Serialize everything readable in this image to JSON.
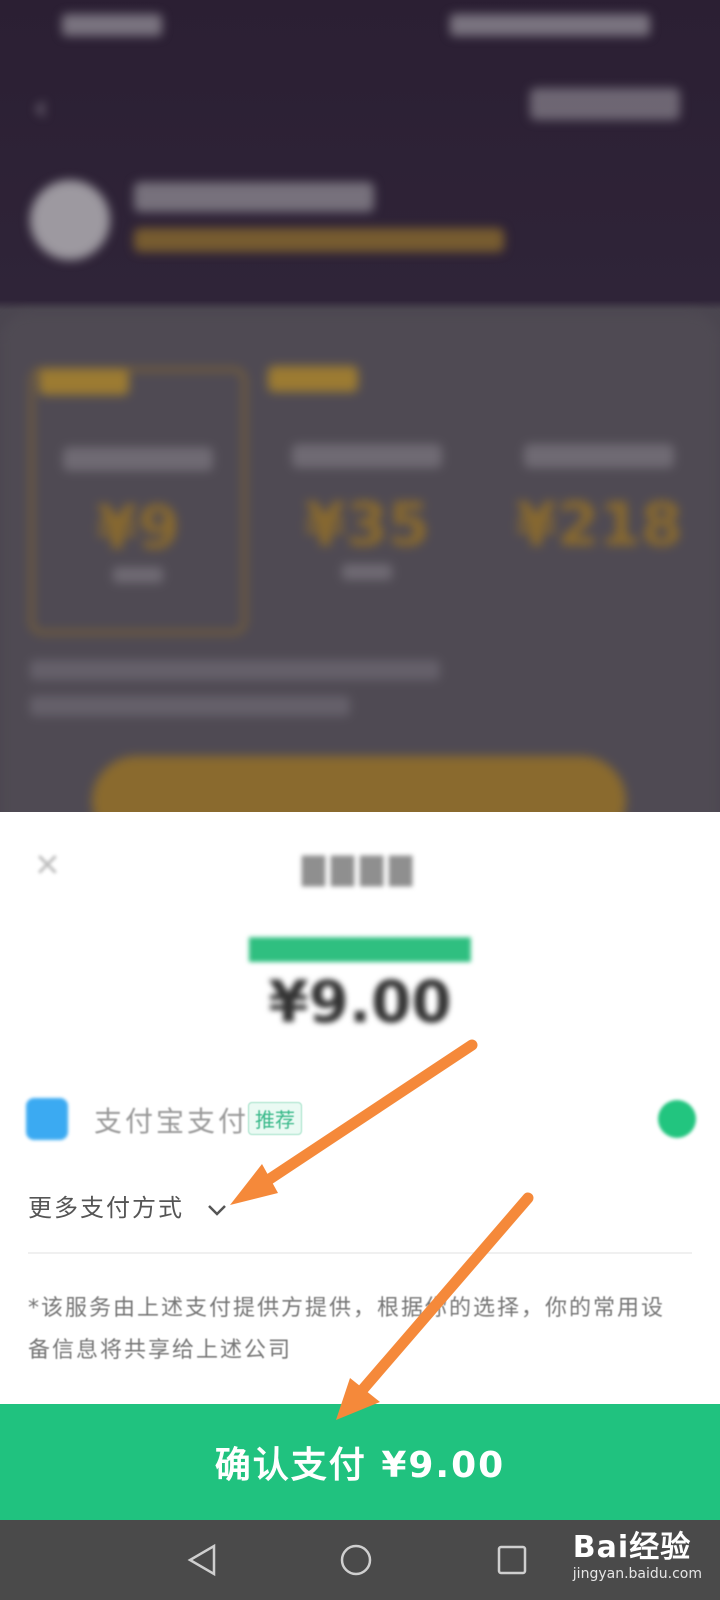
{
  "background": {
    "plans": [
      {
        "price": "¥9"
      },
      {
        "price": "¥35"
      },
      {
        "price": "¥218"
      }
    ]
  },
  "sheet": {
    "close_icon": "close-icon",
    "amount": "¥9.00",
    "payment_methods": [
      {
        "label": "支付宝支付",
        "badge": "推荐",
        "selected": true
      }
    ],
    "more_methods_label": "更多支付方式",
    "disclaimer": "*该服务由上述支付提供方提供，根据你的选择，你的常用设备信息将共享给上述公司",
    "confirm_label": "确认支付 ¥9.00"
  },
  "colors": {
    "accent_green": "#20c27f",
    "annotation_arrow": "#f5893a"
  },
  "watermark": {
    "brand": "Bai经验",
    "url": "jingyan.baidu.com"
  }
}
